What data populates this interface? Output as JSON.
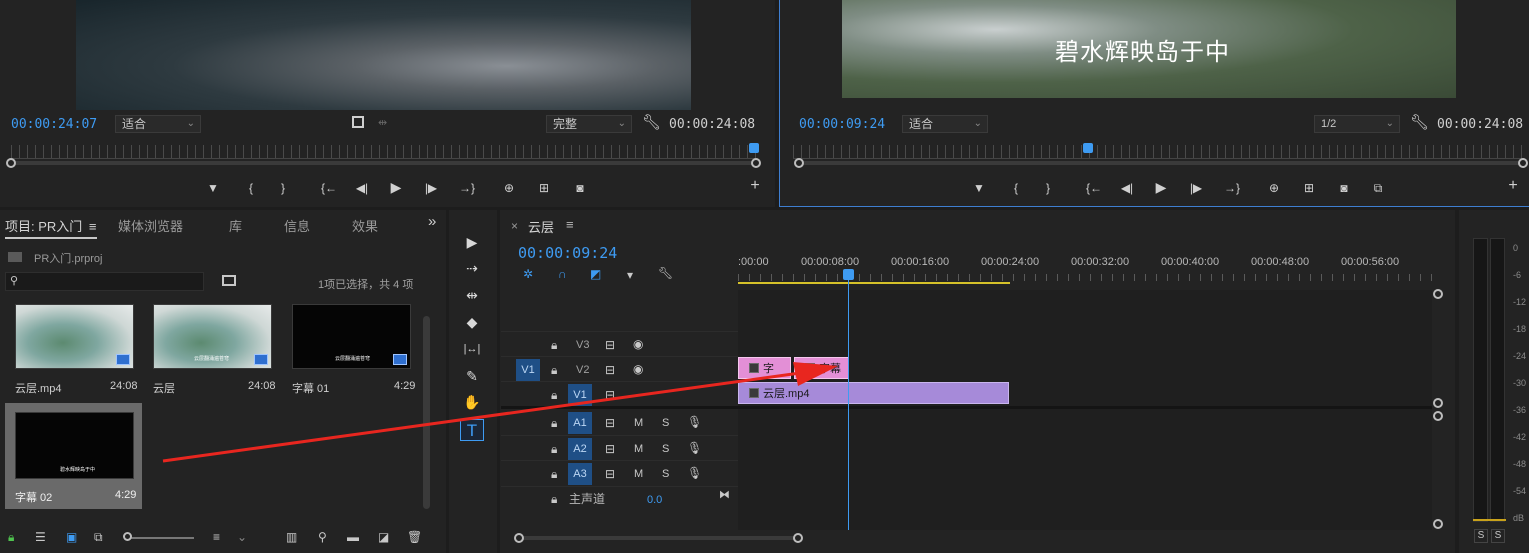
{
  "source_monitor": {
    "timecode": "00:00:24:07",
    "fit_label": "适合",
    "quality_label": "完整",
    "duration": "00:00:24:08"
  },
  "program_monitor": {
    "timecode": "00:00:09:24",
    "fit_label": "适合",
    "resolution_label": "1/2",
    "duration": "00:00:24:08",
    "subtitle_text": "碧水辉映岛于中"
  },
  "transport": {
    "marker": "▼",
    "in": "{",
    "out": "}",
    "go_in": "{←",
    "step_back": "◀|",
    "play": "▶",
    "step_fwd": "|▶",
    "go_out": "→}",
    "insert": "⊕",
    "overwrite": "⊞",
    "export_frame": "◙",
    "compare": "⧉",
    "add": "+"
  },
  "project_panel": {
    "tabs": [
      "项目: PR入门",
      "媒体浏览器",
      "库",
      "信息",
      "效果"
    ],
    "overflow": "»",
    "menu": "≡",
    "project_file": "PR入门.prproj",
    "selection_info": "1项已选择，共 4 项",
    "items": [
      {
        "name": "云层.mp4",
        "duration": "24:08"
      },
      {
        "name": "云层",
        "duration": "24:08"
      },
      {
        "name": "字幕 01",
        "duration": "4:29"
      },
      {
        "name": "字幕 02",
        "duration": "4:29"
      }
    ],
    "thumb_texts": [
      "云层翻涌遍苍穹",
      "云层翻涌遍苍穹",
      "碧水辉映岛于中"
    ]
  },
  "timeline": {
    "tab_close": "×",
    "sequence_name": "云层",
    "menu": "≡",
    "playhead_timecode": "00:00:09:24",
    "ruler_labels": [
      ":00:00",
      "00:00:08:00",
      "00:00:16:00",
      "00:00:24:00",
      "00:00:32:00",
      "00:00:40:00",
      "00:00:48:00",
      "00:00:56:00"
    ],
    "video_tracks": [
      "V3",
      "V2",
      "V1"
    ],
    "audio_tracks": [
      "A1",
      "A2",
      "A3"
    ],
    "source_patch": "V1",
    "mute": "M",
    "solo": "S",
    "master_label": "主声道",
    "master_value": "0.0",
    "clips": {
      "v2_a": "字",
      "v2_b": "字幕",
      "v1": "云层.mp4"
    }
  },
  "tools": [
    "▶",
    "⇢",
    "⇹",
    "◆",
    "|↔|",
    "✎",
    "✋",
    "T"
  ],
  "audio_meter": {
    "scale": [
      "0",
      "-6",
      "-12",
      "-18",
      "-24",
      "-30",
      "-36",
      "-42",
      "-48",
      "-54",
      "dB"
    ],
    "solo_left": "S",
    "solo_right": "S"
  },
  "colors": {
    "accent_blue": "#3e9bf2",
    "clip_pink": "#e38fd6",
    "clip_purple": "#a68ad9",
    "arrow_red": "#e8261f",
    "track_target": "#1f4f86"
  }
}
